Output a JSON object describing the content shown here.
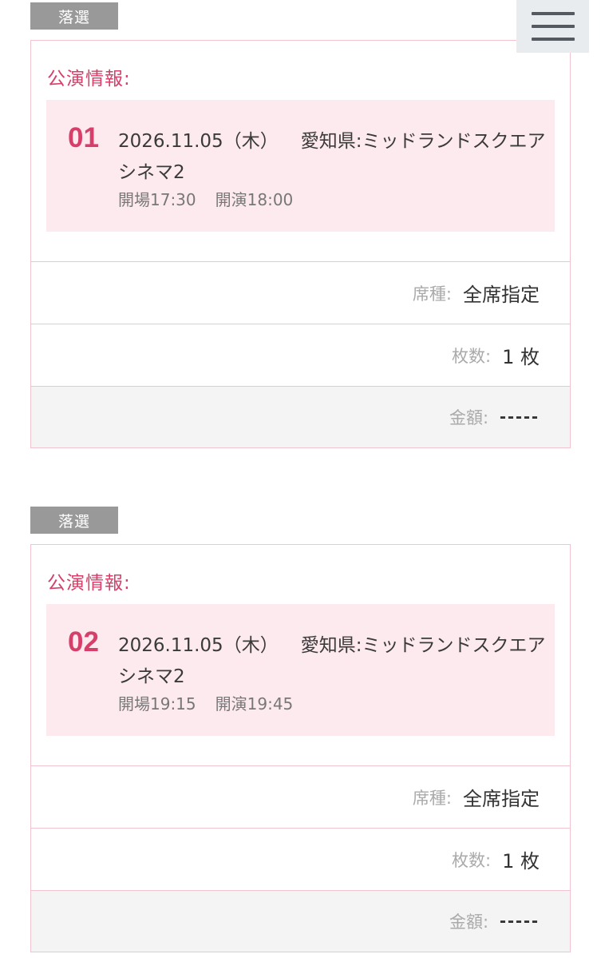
{
  "menu": {
    "icon": "hamburger-menu-icon"
  },
  "entries": [
    {
      "status": "落選",
      "info_label": "公演情報:",
      "number": "01",
      "date": "2026.11.05（木）",
      "venue": "愛知県:ミッドランドスクエア",
      "venue_line2": "シネマ2",
      "open": "開場17:30",
      "start": "開演18:00",
      "seat_label": "席種:",
      "seat_value": "全席指定",
      "qty_label": "枚数:",
      "qty_value": "1 枚",
      "price_label": "金額:",
      "price_value": "-----"
    },
    {
      "status": "落選",
      "info_label": "公演情報:",
      "number": "02",
      "date": "2026.11.05（木）",
      "venue": "愛知県:ミッドランドスクエア",
      "venue_line2": "シネマ2",
      "open": "開場19:15",
      "start": "開演19:45",
      "seat_label": "席種:",
      "seat_value": "全席指定",
      "qty_label": "枚数:",
      "qty_value": "1 枚",
      "price_label": "金額:",
      "price_value": "-----"
    }
  ],
  "colors": {
    "accent": "#d63f6a",
    "badge": "#999999",
    "panel": "#fdeaee",
    "border": "#f2c4cf"
  }
}
